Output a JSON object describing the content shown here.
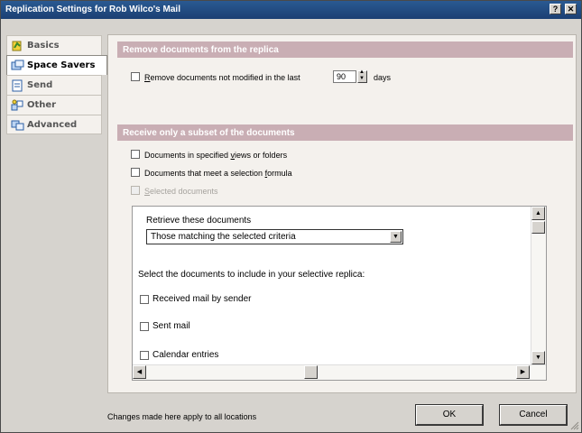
{
  "window": {
    "title": "Replication Settings for Rob Wilco's Mail",
    "help_btn": "?",
    "close_btn": "✕"
  },
  "sidebar": {
    "items": [
      {
        "label": "Basics",
        "icon": "basics-icon"
      },
      {
        "label": "Space Savers",
        "icon": "space-savers-icon",
        "active": true
      },
      {
        "label": "Send",
        "icon": "send-icon"
      },
      {
        "label": "Other",
        "icon": "other-icon"
      },
      {
        "label": "Advanced",
        "icon": "advanced-icon"
      }
    ]
  },
  "section1": {
    "header": "Remove documents from the replica",
    "remove_label_pre": "R",
    "remove_label_rest": "emove documents not modified in the last",
    "days_value": "90",
    "days_unit": "days"
  },
  "section2": {
    "header": "Receive only a subset of the documents",
    "opt1_pre": "Documents in specified ",
    "opt1_u": "v",
    "opt1_post": "iews or folders",
    "opt2_pre": "Documents that meet a selection ",
    "opt2_u": "f",
    "opt2_post": "ormula",
    "opt3_u": "S",
    "opt3_post": "elected documents"
  },
  "panel": {
    "retrieve_label": "Retrieve these documents",
    "retrieve_value": "Those matching the selected criteria",
    "select_label": "Select the documents to include in your selective replica:",
    "items": [
      "Received mail by sender",
      "Sent mail",
      "Calendar entries"
    ]
  },
  "footer": {
    "note": "Changes made here apply to all locations",
    "ok_label": "OK",
    "cancel_label": "Cancel"
  },
  "colors": {
    "title_bar": "#1b3f73",
    "section_header": "#c9aeb4",
    "panel_bg": "#f4f1ed"
  }
}
